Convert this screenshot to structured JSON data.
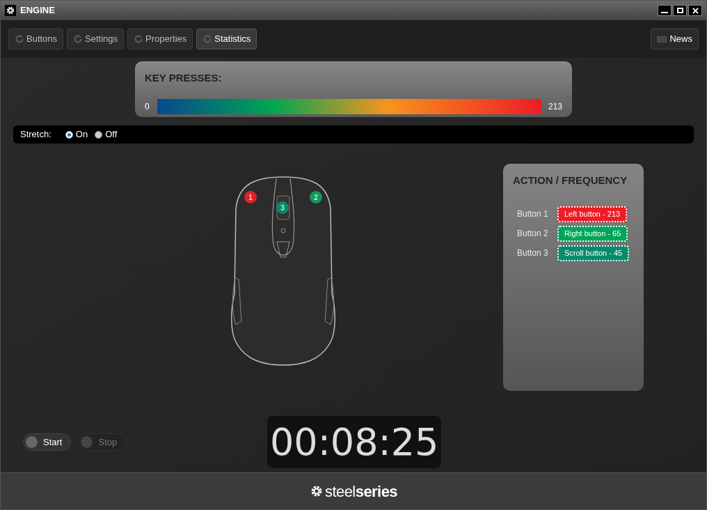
{
  "window": {
    "title": "ENGINE"
  },
  "tabs": [
    {
      "label": "Buttons",
      "selected": false
    },
    {
      "label": "Settings",
      "selected": false
    },
    {
      "label": "Properties",
      "selected": false
    },
    {
      "label": "Statistics",
      "selected": true
    }
  ],
  "news_button": "News",
  "key_presses": {
    "title": "KEY PRESSES:",
    "min": "0",
    "max": "213"
  },
  "stretch": {
    "label": "Stretch:",
    "options": [
      {
        "label": "On",
        "selected": true
      },
      {
        "label": "Off",
        "selected": false
      }
    ]
  },
  "mouse_markers": [
    {
      "number": "1",
      "color": "#e3202a"
    },
    {
      "number": "2",
      "color": "#0f9a5a"
    },
    {
      "number": "3",
      "color": "#0b8a6a"
    }
  ],
  "action_panel": {
    "title": "ACTION / FREQUENCY",
    "rows": [
      {
        "label": "Button 1",
        "value": "Left button - 213",
        "color": "#ee1c25"
      },
      {
        "label": "Button 2",
        "value": "Right button - 65",
        "color": "#00a55a"
      },
      {
        "label": "Button 3",
        "value": "Scroll button - 45",
        "color": "#0a8a6c"
      }
    ]
  },
  "controls": [
    {
      "label": "Start",
      "disabled": false
    },
    {
      "label": "Stop",
      "disabled": true
    }
  ],
  "timer": "00:08:25",
  "footer": {
    "logo": "steel**series**"
  }
}
